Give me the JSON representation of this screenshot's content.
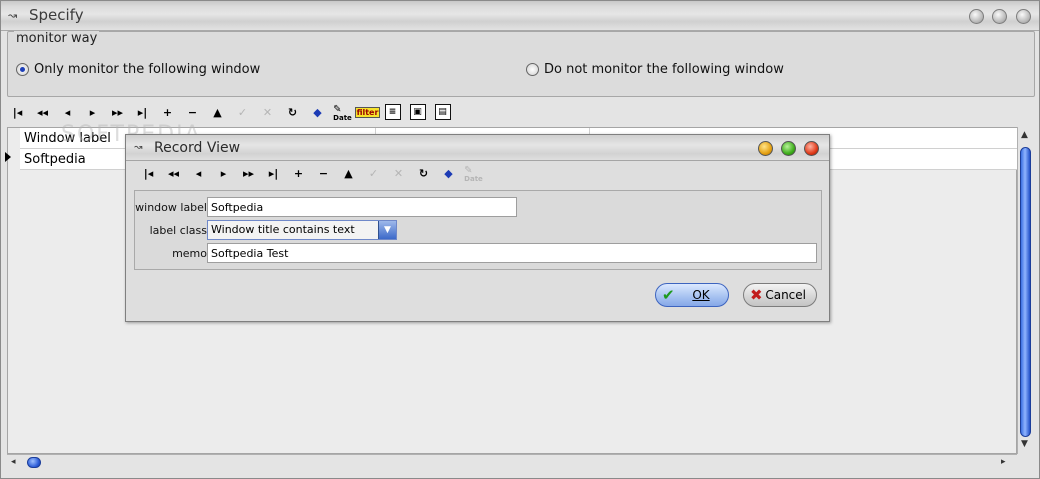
{
  "window": {
    "title": "Specify"
  },
  "monitor_group": {
    "title": "monitor way",
    "option_only": "Only monitor the following window",
    "option_not": "Do not monitor the following window",
    "selected": "only"
  },
  "toolbar": {
    "items": [
      {
        "name": "first-record",
        "glyph": "|◂",
        "enabled": true
      },
      {
        "name": "prior-page",
        "glyph": "◂◂",
        "enabled": true
      },
      {
        "name": "prior-record",
        "glyph": "◂",
        "enabled": true
      },
      {
        "name": "next-record",
        "glyph": "▸",
        "enabled": true
      },
      {
        "name": "next-page",
        "glyph": "▸▸",
        "enabled": true
      },
      {
        "name": "last-record",
        "glyph": "▸|",
        "enabled": true
      },
      {
        "name": "insert",
        "glyph": "+",
        "enabled": true
      },
      {
        "name": "delete",
        "glyph": "−",
        "enabled": true
      },
      {
        "name": "edit",
        "glyph": "▲",
        "enabled": true
      },
      {
        "name": "post",
        "glyph": "✓",
        "enabled": false
      },
      {
        "name": "cancel",
        "glyph": "✕",
        "enabled": false
      },
      {
        "name": "refresh",
        "glyph": "↻",
        "enabled": true
      }
    ],
    "mini_label_1": "Date",
    "filter_label": "filter",
    "mini_label_2": "Date"
  },
  "grid": {
    "column_header": "Window label",
    "rows": [
      {
        "value": "Softpedia"
      }
    ]
  },
  "watermark": "SOFTPEDIA",
  "record_view": {
    "title": "Record View",
    "mini_label": "Date",
    "fields": {
      "window_label": {
        "label": "window label",
        "value": "Softpedia"
      },
      "label_class": {
        "label": "label class",
        "value": "Window title contains text"
      },
      "memo": {
        "label": "memo",
        "value": "Softpedia Test"
      }
    },
    "ok_label": "OK",
    "cancel_label": "Cancel"
  }
}
